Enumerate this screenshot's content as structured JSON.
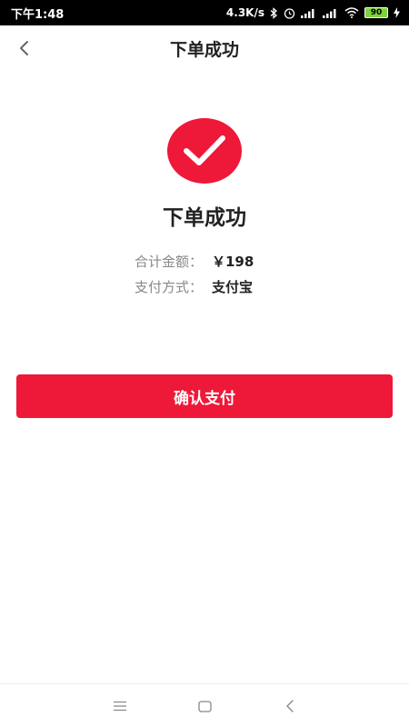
{
  "status_bar": {
    "time": "下午1:48",
    "net_speed": "4.3K/s",
    "battery_level": "90",
    "battery_color": "#7cd43b"
  },
  "nav": {
    "title": "下单成功",
    "back_icon": "chevron-left-icon"
  },
  "result": {
    "icon": "check-icon",
    "title": "下单成功",
    "total_label": "合计金额：",
    "total_value": "￥198",
    "method_label": "支付方式：",
    "method_value": "支付宝"
  },
  "actions": {
    "confirm_label": "确认支付"
  },
  "colors": {
    "accent": "#ee1838"
  },
  "system_nav": {
    "menu_icon": "menu-icon",
    "home_icon": "home-icon",
    "back_icon": "back-icon"
  }
}
